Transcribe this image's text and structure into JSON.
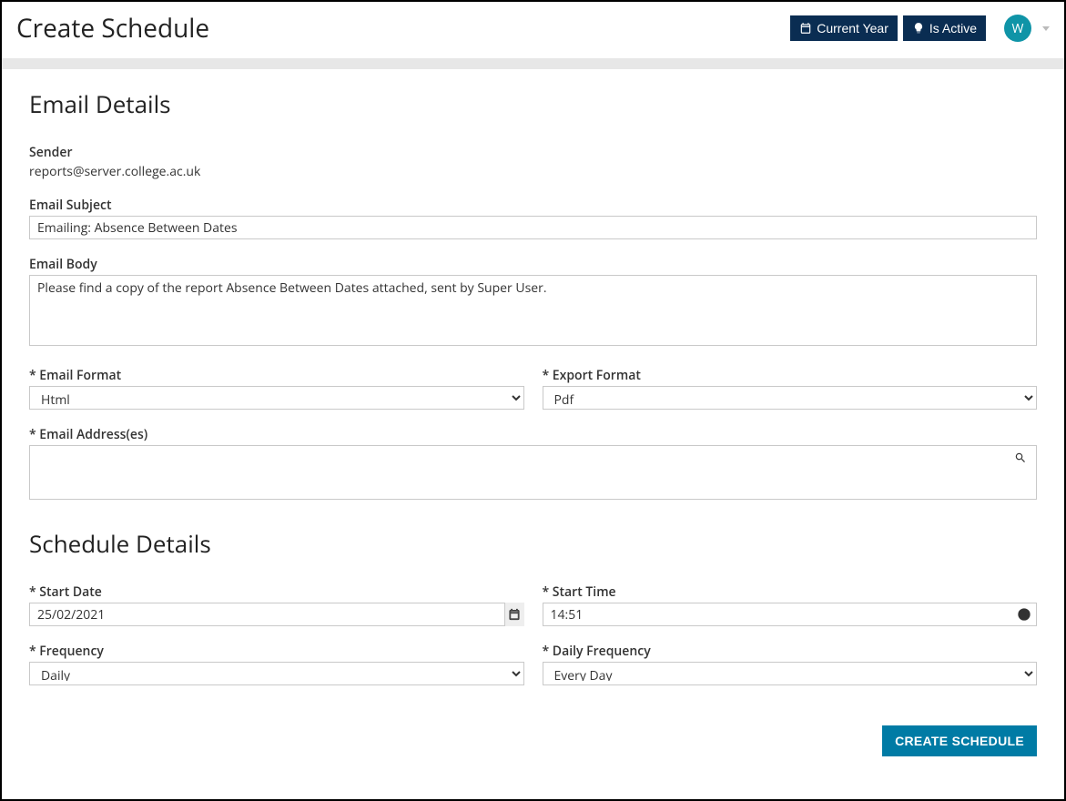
{
  "header": {
    "title": "Create Schedule",
    "current_year_label": "Current Year",
    "is_active_label": "Is Active",
    "avatar_initial": "W"
  },
  "email_details": {
    "section_title": "Email Details",
    "sender_label": "Sender",
    "sender_value": "reports@server.college.ac.uk",
    "subject_label": "Email Subject",
    "subject_value": "Emailing: Absence Between Dates",
    "body_label": "Email Body",
    "body_value": "Please find a copy of the report Absence Between Dates attached, sent by Super User.",
    "email_format_label": "* Email Format",
    "email_format_value": "Html",
    "export_format_label": "* Export Format",
    "export_format_value": "Pdf",
    "addresses_label": "* Email Address(es)"
  },
  "schedule_details": {
    "section_title": "Schedule Details",
    "start_date_label": "* Start Date",
    "start_date_value": "25/02/2021",
    "start_time_label": "* Start Time",
    "start_time_value": "14:51",
    "frequency_label": "* Frequency",
    "frequency_value": "Daily",
    "daily_frequency_label": "* Daily Frequency",
    "daily_frequency_value": "Every Day"
  },
  "actions": {
    "create_button": "CREATE SCHEDULE"
  }
}
